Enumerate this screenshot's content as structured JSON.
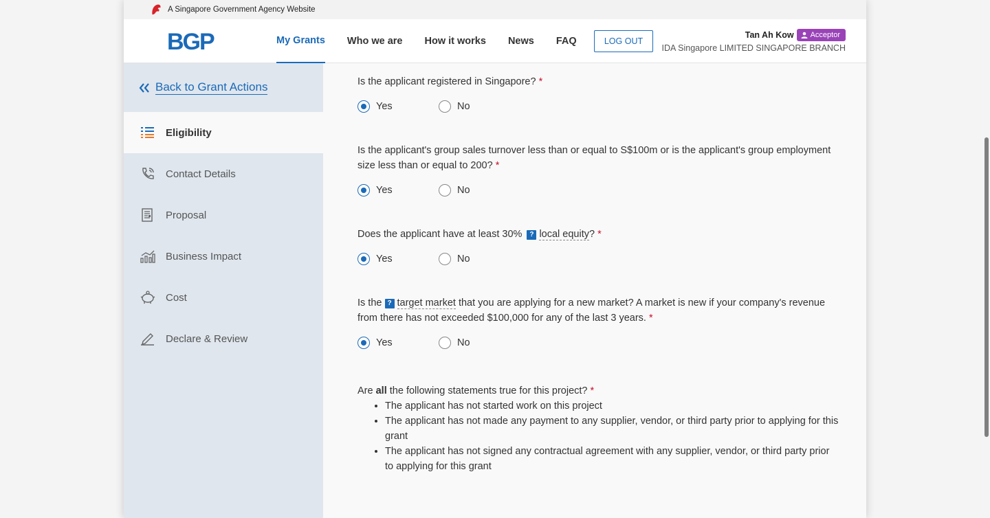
{
  "masthead": {
    "text": "A Singapore Government Agency Website"
  },
  "header": {
    "logo": "BGP",
    "nav": [
      "My Grants",
      "Who we are",
      "How it works",
      "News",
      "FAQ"
    ],
    "logout": "LOG OUT",
    "user_name": "Tan Ah Kow",
    "role": "Acceptor",
    "org": "IDA Singapore LIMITED SINGAPORE BRANCH"
  },
  "sidebar": {
    "back": "Back to Grant Actions",
    "items": [
      {
        "label": "Eligibility",
        "icon": "list-icon",
        "active": true
      },
      {
        "label": "Contact Details",
        "icon": "phone-icon"
      },
      {
        "label": "Proposal",
        "icon": "document-icon"
      },
      {
        "label": "Business Impact",
        "icon": "chart-icon"
      },
      {
        "label": "Cost",
        "icon": "piggy-bank-icon"
      },
      {
        "label": "Declare & Review",
        "icon": "pen-icon"
      }
    ]
  },
  "form": {
    "yes": "Yes",
    "no": "No",
    "required_mark": "*",
    "q1": "Is the applicant registered in Singapore?",
    "q2": "Is the applicant's group sales turnover less than or equal to S$100m or is the applicant's group employment size less than or equal to 200?",
    "q3_pre": "Does the applicant have at least 30%",
    "q3_term": "local equity",
    "q3_post": "?",
    "q4_pre": "Is the",
    "q4_term": "target market",
    "q4_post": " that you are applying for a new market? A market is new if your company's revenue from there has not exceeded $100,000 for any of the last 3 years.",
    "q5_pre": "Are",
    "q5_bold": "all",
    "q5_post": "the following statements true for this project?",
    "q5_items": [
      "The applicant has not started work on this project",
      "The applicant has not made any payment to any supplier, vendor, or third party prior to applying for this grant",
      "The applicant has not signed any contractual agreement with any supplier, vendor, or third party prior to applying for this grant"
    ],
    "help_glyph": "?"
  },
  "colors": {
    "primary": "#1b6ab8",
    "badge": "#9a43b8",
    "required": "#c8102e",
    "sidebar": "#dfe6ee"
  }
}
